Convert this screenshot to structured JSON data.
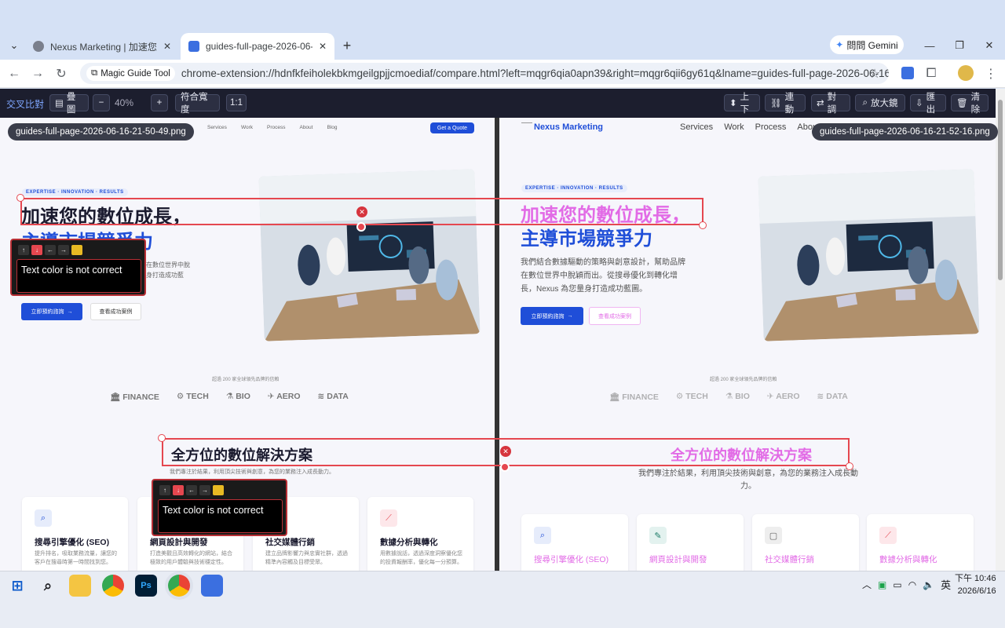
{
  "tabs": [
    {
      "title": "Nexus Marketing | 加速您的數..."
    },
    {
      "title": "guides-full-page-2026-06-16"
    }
  ],
  "gemini_label": "問問 Gemini",
  "omnibox": {
    "chip": "Magic Guide Tool",
    "url": "chrome-extension://hdnfkfeiholekbkmgeilgpjjcmoediaf/compare.html?left=mqgr6qia0apn39&right=mqgr6qii6gy61q&lname=guides-full-page-2026-06-16-..."
  },
  "ext_toolbar": {
    "title": "交叉比對",
    "overlay": "疊圖",
    "minus": "−",
    "zoom": "40%",
    "plus": "+",
    "fit": "符合寬度",
    "one": "1:1",
    "updown": "上下",
    "link": "連動",
    "align": "對調",
    "magnifier": "放大鏡",
    "export": "匯出",
    "clear": "清除"
  },
  "left_file": "guides-full-page-2026-06-16-21-50-49.png",
  "right_file": "guides-full-page-2026-06-16-21-52-16.png",
  "site": {
    "logo": "Nexus Marketing",
    "nav": [
      "Services",
      "Work",
      "Process",
      "About",
      "Blog"
    ],
    "cta": "Get a Quote",
    "tag": "EXPERTISE · INNOVATION · RESULTS",
    "hero_line1": "加速您的數位成長，",
    "hero_line2": "主導市場競爭力",
    "hero_desc_left_1": "在數位世界中脫",
    "hero_desc_left_2": "身打造成功藍",
    "hero_desc_1": "我們結合數據驅動的策略與創意設計，幫助品牌",
    "hero_desc_2": "在數位世界中脫穎而出。從搜尋優化到轉化增",
    "hero_desc_3": "長，Nexus 為您量身打造成功藍圖。",
    "btn_primary": "立即預約諮詢",
    "btn_secondary": "查看成功案例",
    "trusted": "超過 200 家全球領先品牌的信賴",
    "brands": [
      "FINANCE",
      "TECH",
      "BIO",
      "AERO",
      "DATA"
    ],
    "section_title": "全方位的數位解決方案",
    "section_sub_left": "我們專注於結果，利用頂尖技術與創意，為您的業務注入成長動力。",
    "section_sub_right_1": "我們專注於結果，利用頂尖技術與創意，為您的業務注入成長動",
    "section_sub_right_2": "力。",
    "cards": [
      {
        "title": "搜尋引擎優化 (SEO)",
        "text": "提升排名，吸取業務流量，讓您的客戶在搜尋時第一時間找到您。"
      },
      {
        "title": "網頁設計與開發",
        "text": "打造美觀且高效轉化的網站，結合極致的用戶體驗與技術穩定性。"
      },
      {
        "title": "社交媒體行銷",
        "text": "建立品牌影響力與忠實社群，透過精準內容觸及目標受眾。"
      },
      {
        "title": "數據分析與轉化",
        "text": "用數據說話，透過深度洞察優化您的投資報酬率，優化每一分預算。"
      }
    ]
  },
  "annotations": [
    {
      "comment": "Text color is not correct"
    },
    {
      "comment": "Text color is not correct"
    }
  ],
  "popup_buttons": [
    "↑",
    "↓",
    "←",
    "→",
    "🔒"
  ],
  "clock": {
    "time": "下午 10:46",
    "date": "2026/6/16"
  },
  "tray": {
    "ime": "英"
  },
  "colors": {
    "accent": "#1f4ed8",
    "magenta": "#e26be6",
    "annotation": "#e5474f"
  }
}
